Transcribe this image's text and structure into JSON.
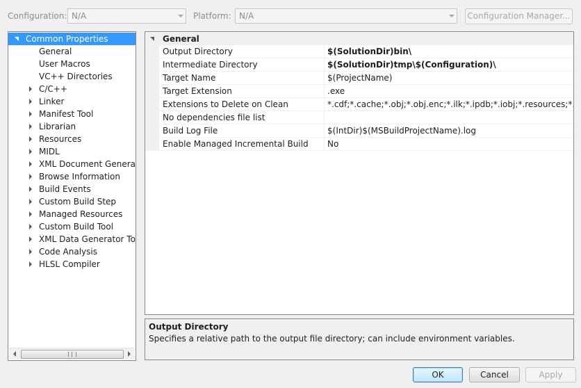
{
  "toolbar": {
    "configuration_label": "Configuration:",
    "configuration_value": "N/A",
    "platform_label": "Platform:",
    "platform_value": "N/A",
    "config_manager_label": "Configuration Manager..."
  },
  "tree": {
    "items": [
      {
        "label": "Common Properties",
        "expander": "open",
        "selected": true
      },
      {
        "label": "General"
      },
      {
        "label": "User Macros"
      },
      {
        "label": "VC++ Directories"
      },
      {
        "label": "C/C++",
        "expander": "closed"
      },
      {
        "label": "Linker",
        "expander": "closed"
      },
      {
        "label": "Manifest Tool",
        "expander": "closed"
      },
      {
        "label": "Librarian",
        "expander": "closed"
      },
      {
        "label": "Resources",
        "expander": "closed"
      },
      {
        "label": "MIDL",
        "expander": "closed"
      },
      {
        "label": "XML Document Generator",
        "expander": "closed"
      },
      {
        "label": "Browse Information",
        "expander": "closed"
      },
      {
        "label": "Build Events",
        "expander": "closed"
      },
      {
        "label": "Custom Build Step",
        "expander": "closed"
      },
      {
        "label": "Managed Resources",
        "expander": "closed"
      },
      {
        "label": "Custom Build Tool",
        "expander": "closed"
      },
      {
        "label": "XML Data Generator Tool",
        "expander": "closed"
      },
      {
        "label": "Code Analysis",
        "expander": "closed"
      },
      {
        "label": "HLSL Compiler",
        "expander": "closed"
      }
    ]
  },
  "grid": {
    "category": "General",
    "rows": [
      {
        "name": "Output Directory",
        "value": "$(SolutionDir)bin\\",
        "bold": true
      },
      {
        "name": "Intermediate Directory",
        "value": "$(SolutionDir)tmp\\$(Configuration)\\",
        "bold": true
      },
      {
        "name": "Target Name",
        "value": "$(ProjectName)",
        "bold": false
      },
      {
        "name": "Target Extension",
        "value": ".exe",
        "bold": false
      },
      {
        "name": "Extensions to Delete on Clean",
        "value": "*.cdf;*.cache;*.obj;*.obj.enc;*.ilk;*.ipdb;*.iobj;*.resources;*.tlb;*.tli;*.t",
        "bold": false
      },
      {
        "name": "No dependencies file list",
        "value": "",
        "bold": false
      },
      {
        "name": "Build Log File",
        "value": "$(IntDir)$(MSBuildProjectName).log",
        "bold": false
      },
      {
        "name": "Enable Managed Incremental Build",
        "value": "No",
        "bold": false
      }
    ]
  },
  "description": {
    "title": "Output Directory",
    "text": "Specifies a relative path to the output file directory; can include environment variables."
  },
  "buttons": {
    "ok": "OK",
    "cancel": "Cancel",
    "apply": "Apply"
  }
}
